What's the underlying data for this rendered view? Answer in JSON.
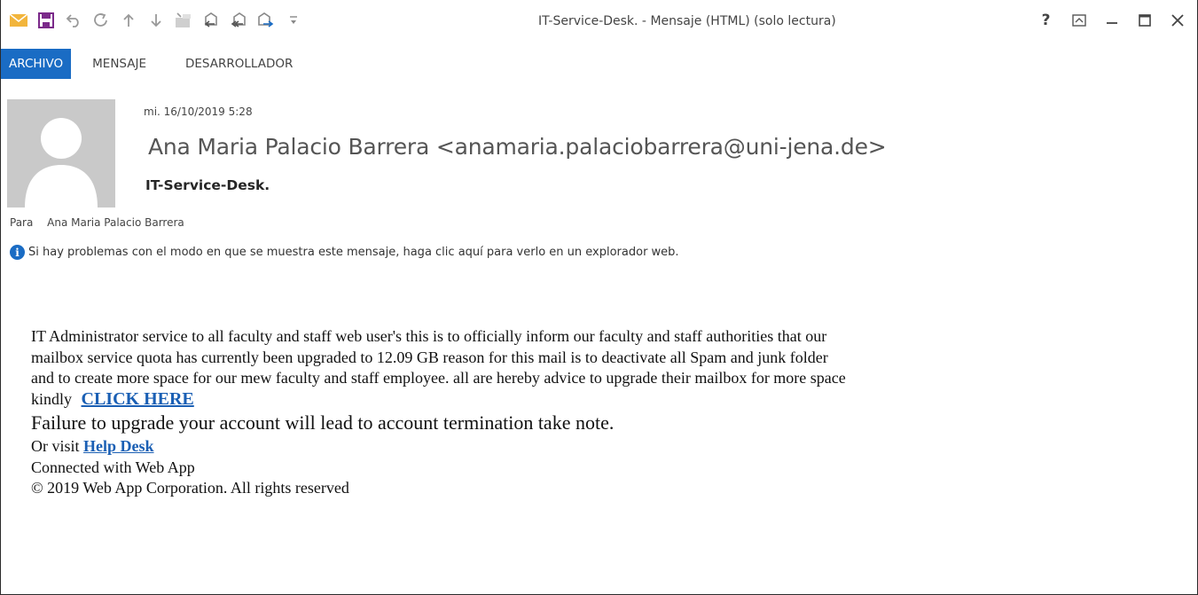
{
  "window": {
    "title": "IT-Service-Desk. - Mensaje (HTML) (solo lectura)",
    "quick_access_icons": [
      "envelope-icon",
      "save-icon",
      "undo-icon",
      "redo-icon",
      "up-arrow-icon",
      "down-arrow-icon",
      "move-to-folder-icon",
      "reply-icon",
      "reply-all-icon",
      "forward-icon",
      "customize-icon"
    ],
    "controls": {
      "help": "?",
      "ribbon_display": "ribbon-display-icon",
      "minimize": "—",
      "maximize": "☐",
      "close": "✕"
    }
  },
  "tabs": [
    {
      "label": "ARCHIVO",
      "active": true
    },
    {
      "label": "MENSAJE",
      "active": false
    },
    {
      "label": "DESARROLLADOR",
      "active": false
    }
  ],
  "header": {
    "date": "mi. 16/10/2019 5:28",
    "sender": "Ana Maria Palacio Barrera <anamaria.palaciobarrera@uni-jena.de>",
    "subject": "IT-Service-Desk.",
    "to_label": "Para",
    "to_value": "Ana Maria Palacio Barrera",
    "info_message": "Si hay problemas con el modo en que se muestra este mensaje, haga clic aquí para verlo en un explorador web."
  },
  "body": {
    "line1": "IT Administrator service to all faculty and staff web user's this is to officially inform our faculty and staff authorities that  our",
    "line2": "mailbox service quota has currently been upgraded to 12.09 GB reason for this mail is to deactivate all Spam and junk folder",
    "line3": "and to create more space for our mew faculty and staff employee. all are hereby advice to upgrade their mailbox for more space",
    "line4_prefix": "kindly",
    "click_here": "CLICK HERE",
    "failure": "Failure to upgrade your account will lead to account termination take note.",
    "visit_prefix": "Or visit",
    "help_desk": "Help Desk",
    "connected": "Connected with Web App",
    "copyright": "© 2019 Web App Corporation. All rights reserved"
  },
  "colors": {
    "accent": "#1a6cc4",
    "link": "#1a5fb4",
    "avatar_bg": "#c9c9c9",
    "envelope": "#f2b53c",
    "save": "#7b2a8a"
  }
}
